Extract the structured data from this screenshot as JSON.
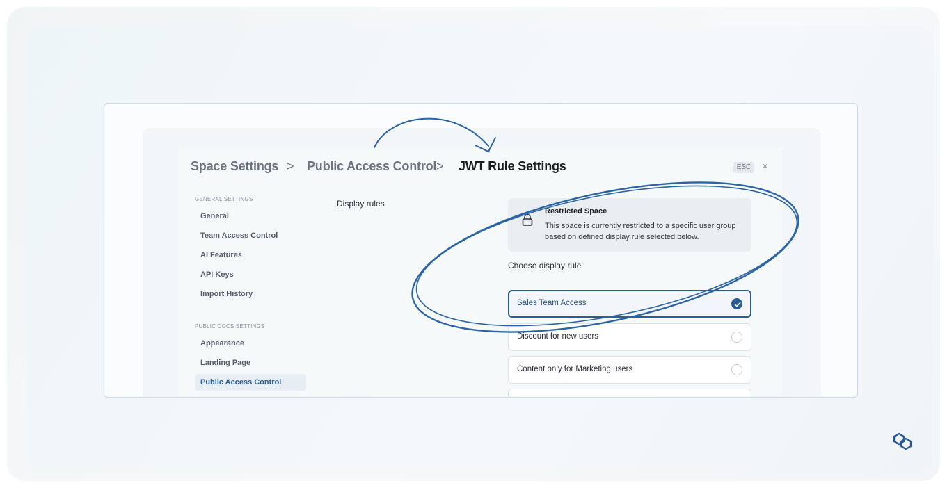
{
  "breadcrumb": {
    "items": [
      "Space Settings",
      "Public Access Control",
      "JWT Rule Settings"
    ],
    "separator": ">"
  },
  "modal": {
    "esc_label": "ESC",
    "close_glyph": "×"
  },
  "sidebar": {
    "general_title": "GENERAL SETTINGS",
    "general_items": [
      "General",
      "Team Access Control",
      "AI Features",
      "API Keys",
      "Import History"
    ],
    "public_title": "PUBLIC DOCS SETTINGS",
    "public_items": [
      "Appearance",
      "Landing Page",
      "Public Access Control"
    ],
    "active_item": "Public Access Control"
  },
  "main": {
    "display_rules_label": "Display rules",
    "restricted": {
      "title": "Restricted Space",
      "body": "This space is currently restricted to a specific user group based on defined display rule selected below.",
      "icon": "lock-icon"
    },
    "choose_label": "Choose display rule",
    "rules": [
      {
        "label": "Sales Team Access",
        "selected": true
      },
      {
        "label": "Discount for new users",
        "selected": false
      },
      {
        "label": "Content only for Marketing users",
        "selected": false
      }
    ]
  },
  "colors": {
    "accent": "#2b5d95",
    "annotation": "#2a63a6"
  }
}
